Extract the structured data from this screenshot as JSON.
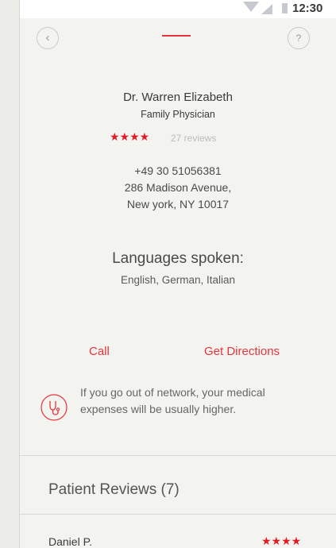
{
  "status_bar": {
    "time": "12:30",
    "icons": [
      "wifi-icon",
      "signal-icon",
      "battery-icon"
    ]
  },
  "header": {
    "back_icon": "‹",
    "help_icon": "?"
  },
  "doctor": {
    "name": "Dr. Warren Elizabeth",
    "role": "Family Physician",
    "rating_stars": "★★★★",
    "rating": 4,
    "review_count": "27 reviews",
    "phone": "+49 30 51056381",
    "address_line1": "286 Madison Avenue,",
    "address_line2": "New york, NY 10017"
  },
  "languages": {
    "title": "Languages spoken:",
    "list": "English, German, Italian"
  },
  "actions": {
    "call": "Call",
    "directions": "Get Directions"
  },
  "notice": {
    "line1": "If you go out of network, your medical",
    "line2": "expenses will be usually higher.",
    "icon": "stethoscope-icon"
  },
  "reviews": {
    "title": "Patient Reviews (7)",
    "items": [
      {
        "name": "Daniel P.",
        "stars": "★★★★",
        "rating": 4
      }
    ]
  },
  "colors": {
    "accent": "#e8343c",
    "star": "#e21b26",
    "background": "#f3f4f0"
  }
}
